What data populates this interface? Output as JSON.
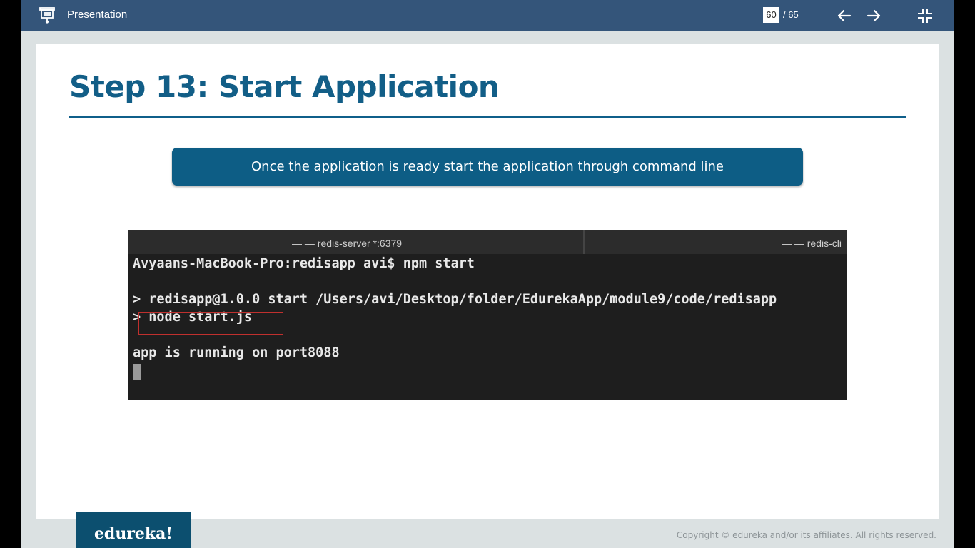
{
  "topbar": {
    "title": "Presentation",
    "current_page": "60",
    "total_pages": "/ 65",
    "icons": [
      "presentation-icon",
      "arrow-left-icon",
      "arrow-right-icon",
      "exit-fullscreen-icon"
    ]
  },
  "slide": {
    "title": "Step 13: Start Application",
    "callout": "Once the application is ready start the application through command line",
    "terminal": {
      "tabs": [
        "— — redis-server *:6379",
        "— — redis-cli"
      ],
      "lines": [
        "Avyaans-MacBook-Pro:redisapp avi$ npm start",
        "> redisapp@1.0.0 start /Users/avi/Desktop/folder/EdurekaApp/module9/code/redisapp",
        "> node start.js",
        "app is running on port8088"
      ]
    }
  },
  "footer": {
    "logo": "edureka!",
    "copyright": "Copyright © edureka and/or its affiliates. All rights reserved."
  },
  "colors": {
    "topbar": "#34557a",
    "title": "#125e87",
    "callout_bg": "#0d5d85",
    "highlight": "#c0302e"
  }
}
